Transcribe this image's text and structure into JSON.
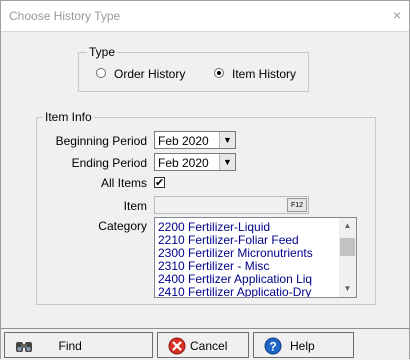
{
  "window": {
    "title": "Choose History Type",
    "close_glyph": "×"
  },
  "type_group": {
    "legend": "Type",
    "options": [
      {
        "label": "Order History",
        "selected": false
      },
      {
        "label": "Item History",
        "selected": true
      }
    ]
  },
  "item_info": {
    "legend": "Item Info",
    "beginning_period": {
      "label": "Beginning Period",
      "value": "Feb 2020"
    },
    "ending_period": {
      "label": "Ending Period",
      "value": "Feb 2020"
    },
    "all_items": {
      "label": "All Items",
      "checked": true,
      "glyph": "✔"
    },
    "item": {
      "label": "Item",
      "value": "",
      "key_hint": "F12"
    },
    "category": {
      "label": "Category",
      "items": [
        "2200 Fertilizer-Liquid",
        "2210 Fertilizer-Foliar Feed",
        "2300 Fertilizer Micronutrients",
        "2310 Fertilizer - Misc",
        "2400 Fertlizer Application Liq",
        "2410 Fertilizer Applicatio-Dry"
      ]
    }
  },
  "buttons": {
    "find": "Find",
    "cancel": "Cancel",
    "help": "Help"
  },
  "icons": {
    "find": "binoculars-icon",
    "cancel": "cancel-icon",
    "help": "help-icon",
    "dropdown": "chevron-down-icon"
  },
  "colors": {
    "list_text": "#00008b",
    "cancel_icon": "#d93025",
    "help_icon": "#1e66c8"
  }
}
